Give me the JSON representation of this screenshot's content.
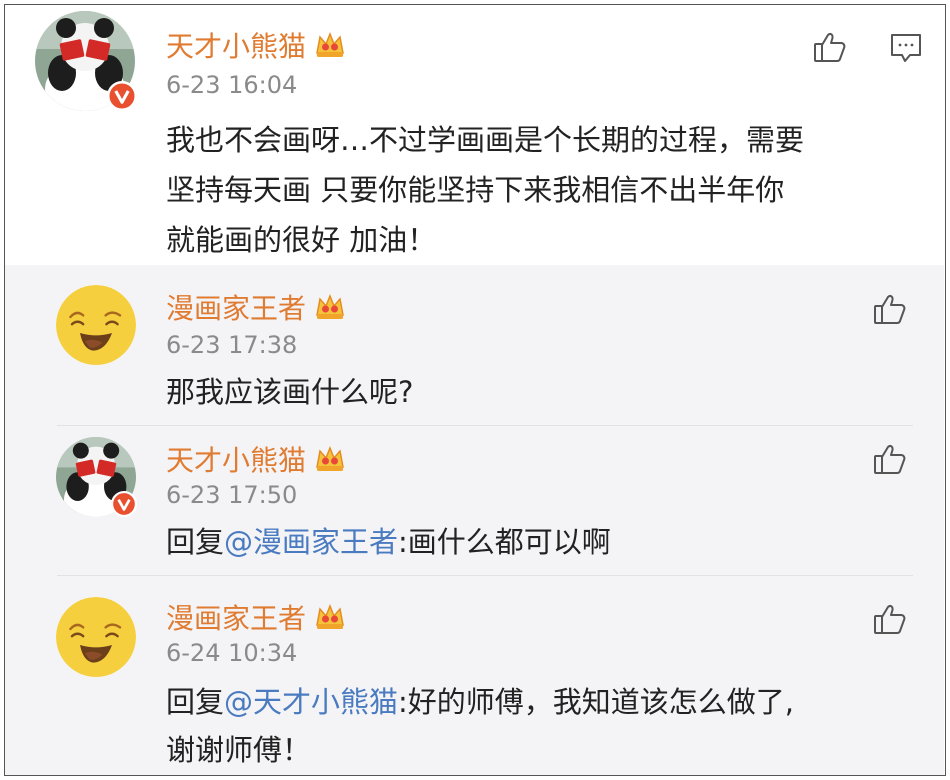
{
  "post": {
    "author": "天才小熊猫",
    "time": "6-23 16:04",
    "lines": [
      "我也不会画呀…不过学画画是个长期的过程，需要",
      "坚持每天画 只要你能坚持下来我相信不出半年你",
      "就能画的很好 加油！"
    ],
    "icons": [
      "like-icon",
      "comment-icon"
    ]
  },
  "replies": [
    {
      "author": "漫画家王者",
      "time": "6-23 17:38",
      "text": "那我应该画什么呢?"
    },
    {
      "author": "天才小熊猫",
      "time": "6-23 17:50",
      "prefix": "回复",
      "mention": "@漫画家王者",
      "rest": ":画什么都可以啊"
    },
    {
      "author": "漫画家王者",
      "time": "6-24 10:34",
      "prefix": "回复",
      "mention": "@天才小熊猫",
      "rest": ":好的师傅，我知道该怎么做了,",
      "line2": "谢谢师傅！"
    }
  ],
  "colors": {
    "name": "#e07b32",
    "mention": "#4a7bc0",
    "time": "#8a8a8a",
    "verified": "#e8502f"
  }
}
